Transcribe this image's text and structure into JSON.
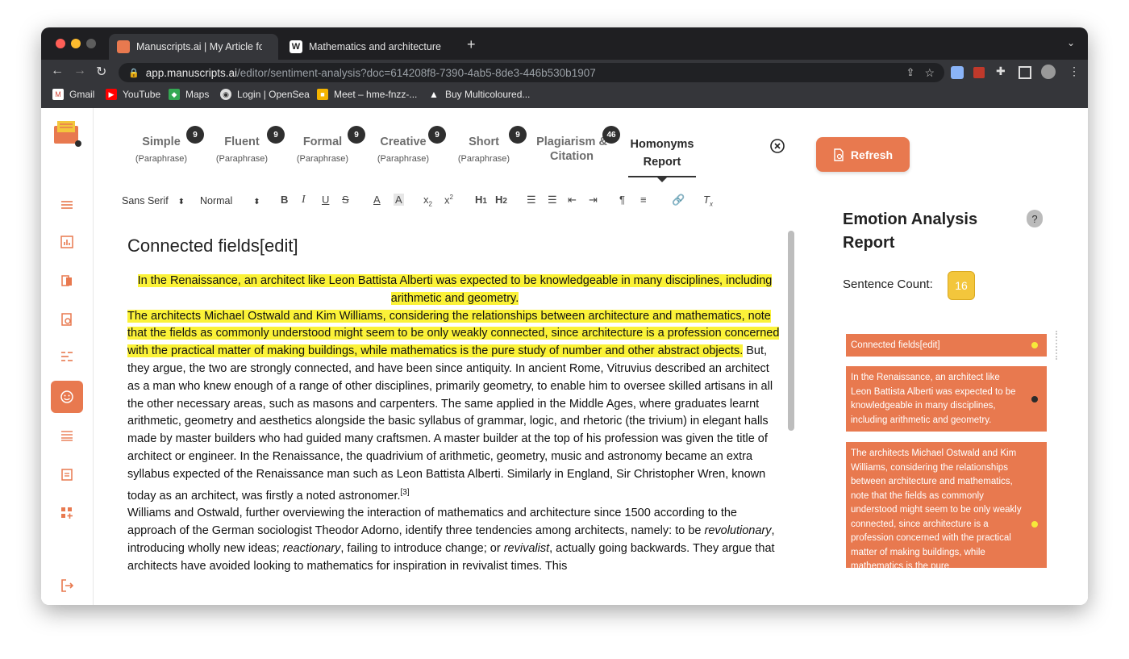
{
  "browser": {
    "tabs": [
      {
        "title": "Manuscripts.ai | My Article for",
        "favicon": "manuscripts-favicon"
      },
      {
        "title": "Mathematics and architecture",
        "favicon": "wikipedia-favicon",
        "favicon_text": "W"
      }
    ],
    "new_tab_label": "+",
    "url": {
      "host": "app.manuscripts.ai",
      "path": "/editor/sentiment-analysis?doc=614208f8-7390-4ab5-8de3-446b530b1907"
    },
    "bookmarks": [
      "Gmail",
      "YouTube",
      "Maps",
      "Login | OpenSea",
      "Meet – hme-fnzz-...",
      "Buy Multicoloured..."
    ]
  },
  "modes": [
    {
      "title": "Simple",
      "sub": "(Paraphrase)",
      "badge": "9"
    },
    {
      "title": "Fluent",
      "sub": "(Paraphrase)",
      "badge": "9"
    },
    {
      "title": "Formal",
      "sub": "(Paraphrase)",
      "badge": "9"
    },
    {
      "title": "Creative",
      "sub": "(Paraphrase)",
      "badge": "9"
    },
    {
      "title": "Short",
      "sub": "(Paraphrase)",
      "badge": "9"
    },
    {
      "title": "Plagiarism &",
      "sub": "Citation",
      "badge": "46"
    }
  ],
  "homonyms": {
    "line1": "Homonyms",
    "line2": "Report"
  },
  "refresh_label": "Refresh",
  "toolbar": {
    "font": "Sans Serif",
    "size": "Normal"
  },
  "editor": {
    "heading": "Connected fields[edit]",
    "p1": "In the Renaissance, an architect like Leon Battista Alberti was expected to be knowledgeable in many disciplines, including arithmetic and geometry.",
    "p2_hl": "The architects Michael Ostwald and Kim Williams, considering the relationships between architecture and mathematics, note that the fields as commonly understood might seem to be only weakly connected, since architecture is a profession concerned with the practical matter of making buildings, while mathematics is the pure study of number and other abstract objects.",
    "p2_rest": " But, they argue, the two are strongly connected, and have been since antiquity. In ancient Rome, Vitruvius described an architect as a man who knew enough of a range of other disciplines, primarily geometry, to enable him to oversee skilled artisans in all the other necessary areas, such as masons and carpenters. The same applied in the Middle Ages, where graduates learnt arithmetic, geometry and aesthetics alongside the basic syllabus of grammar, logic, and rhetoric (the trivium) in elegant halls made by master builders who had guided many craftsmen. A master builder at the top of his profession was given the title of architect or engineer. In the Renaissance, the quadrivium of arithmetic, geometry, music and astronomy became an extra syllabus expected of the Renaissance man such as Leon Battista Alberti. Similarly in England, Sir Christopher Wren, known today as an architect, was firstly a noted astronomer.",
    "cite": "[3]",
    "p3_a": "Williams and Ostwald, further overviewing the interaction of mathematics and architecture since 1500 according to the approach of the German sociologist Theodor Adorno, identify three tendencies among architects, namely: to be ",
    "p3_i1": "revolutionary",
    "p3_b": ", introducing wholly new ideas; ",
    "p3_i2": "reactionary",
    "p3_c": ", failing to introduce change; or ",
    "p3_i3": "revivalist",
    "p3_d": ", actually going backwards. They argue that architects have avoided looking to mathematics for inspiration in revivalist times. This"
  },
  "report": {
    "title_line1": "Emotion Analysis",
    "title_line2": "Report",
    "help": "?",
    "sentence_count_label": "Sentence Count:",
    "sentence_count": "16",
    "cards": [
      {
        "text": "Connected fields[edit]",
        "dot": "#f7e93a"
      },
      {
        "text": "In the Renaissance, an architect like Leon Battista Alberti was expected to be knowledgeable in many disciplines, including arithmetic and geometry.",
        "dot": "#2b2b2b"
      },
      {
        "text": "The architects Michael Ostwald and Kim Williams, considering the relationships between architecture and mathematics, note that the fields as commonly understood might seem to be only weakly connected, since architecture is a profession concerned with the practical matter of making buildings, while mathematics is the pure",
        "dot": "#f7e93a"
      }
    ]
  },
  "colors": {
    "accent": "#e8794f",
    "highlight": "#fbf238"
  }
}
